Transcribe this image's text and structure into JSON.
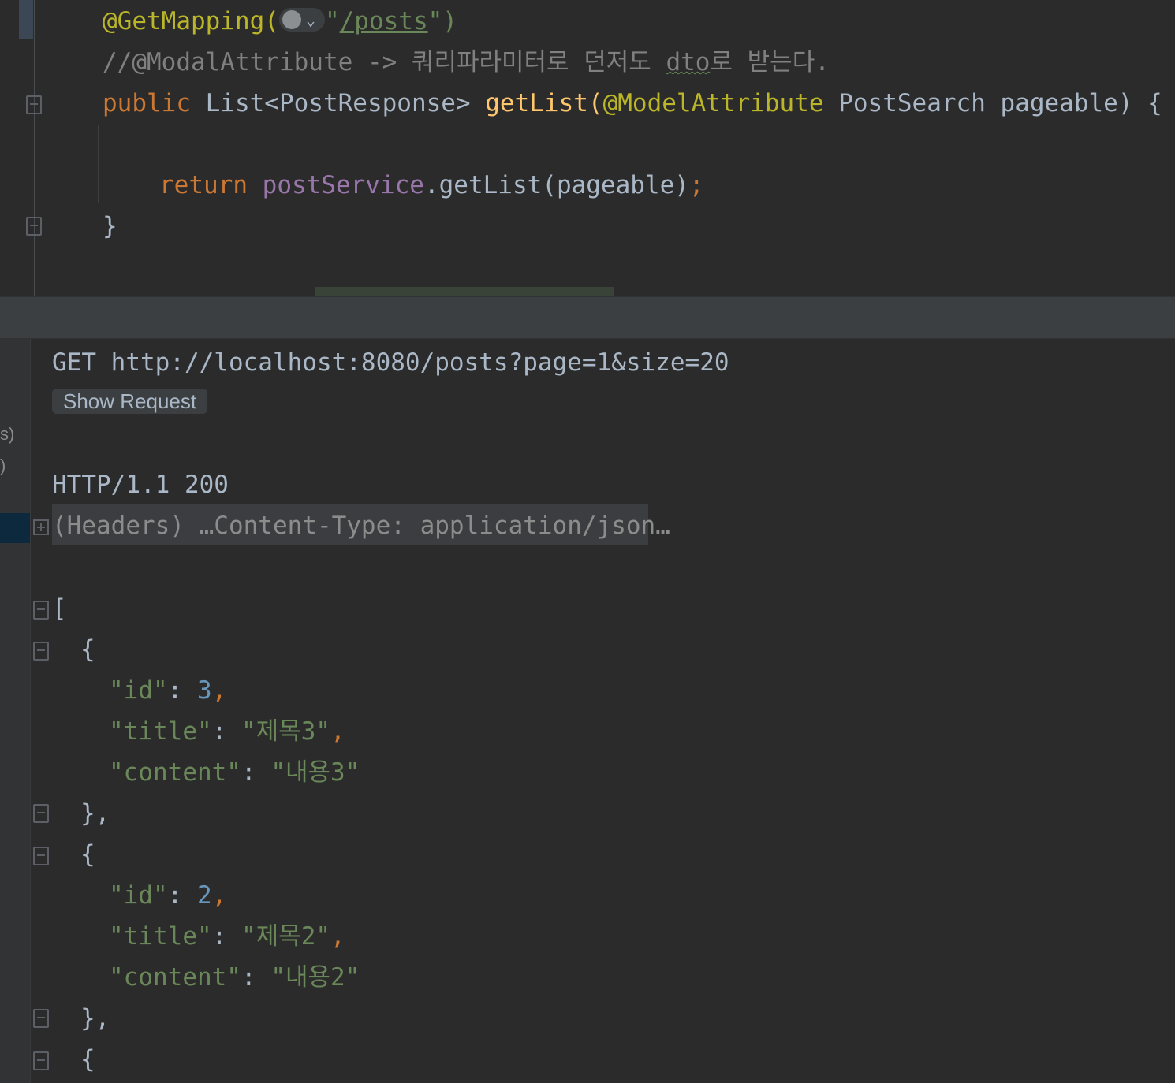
{
  "editor": {
    "line1": {
      "annotation": "@GetMapping(",
      "quote_open": "\"",
      "path": "/posts",
      "close": "\")"
    },
    "line2": {
      "comment_prefix": "//@ModalAttribute -> 쿼리파라미터로 던저도 ",
      "comment_dto": "dto",
      "comment_suffix": "로 받는다."
    },
    "line3": {
      "kw_public": "public",
      "type": " List<PostResponse> ",
      "method": "getList",
      "paren_open": "(",
      "param_ann": "@ModelAttribute",
      "param_type": " PostSearch ",
      "param_name": "pageable",
      "tail": ") {"
    },
    "line5": {
      "kw_return": "return",
      "space": " ",
      "field": "postService",
      "call": ".getList(pageable)",
      "semi": ";"
    },
    "line6": {
      "brace": "}"
    }
  },
  "response": {
    "side_labels": [
      "s)",
      ")"
    ],
    "request_line": "GET http://localhost:8080/posts?page=1&size=20",
    "show_request_label": "Show Request",
    "status_line": "HTTP/1.1 200",
    "headers_summary": "(Headers) …Content-Type: application/json…",
    "json_open": "[",
    "items": [
      {
        "id": "3",
        "title": "\"제목3\"",
        "content": "\"내용3\""
      },
      {
        "id": "2",
        "title": "\"제목2\"",
        "content": "\"내용2\""
      }
    ],
    "brace_open": "{",
    "brace_close": "},",
    "key_id": "\"id\"",
    "key_title": "\"title\"",
    "key_content": "\"content\"",
    "colon": ": ",
    "comma": ","
  }
}
